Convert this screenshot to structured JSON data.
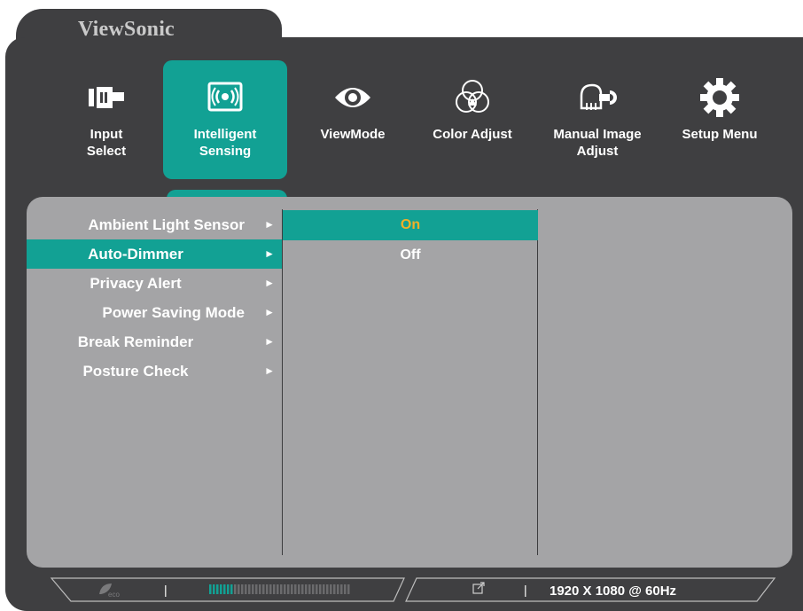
{
  "brand": "ViewSonic",
  "colors": {
    "accent": "#12a194",
    "selected_text": "#f2b027",
    "panel": "#a4a4a6",
    "frame": "#3f3f41"
  },
  "menu": {
    "items": [
      {
        "label": "Input\nSelect",
        "icon": "input-select-icon"
      },
      {
        "label": "Intelligent\nSensing",
        "icon": "intelligent-sensing-icon",
        "active": true
      },
      {
        "label": "ViewMode",
        "icon": "eye-icon"
      },
      {
        "label": "Color Adjust",
        "icon": "color-circles-icon"
      },
      {
        "label": "Manual Image\nAdjust",
        "icon": "hand-wrench-icon"
      },
      {
        "label": "Setup Menu",
        "icon": "gear-icon"
      }
    ]
  },
  "submenu": {
    "items": [
      {
        "label": "Ambient Light Sensor"
      },
      {
        "label": "Auto-Dimmer",
        "active": true
      },
      {
        "label": "Privacy Alert"
      },
      {
        "label": "Power Saving Mode"
      },
      {
        "label": "Break Reminder"
      },
      {
        "label": "Posture Check"
      }
    ],
    "arrow": "►"
  },
  "options": {
    "items": [
      {
        "label": "On",
        "selected": true
      },
      {
        "label": "Off"
      }
    ]
  },
  "status": {
    "separator": "|",
    "eco_label": "eco",
    "resolution": "1920 X 1080 @ 60Hz"
  }
}
